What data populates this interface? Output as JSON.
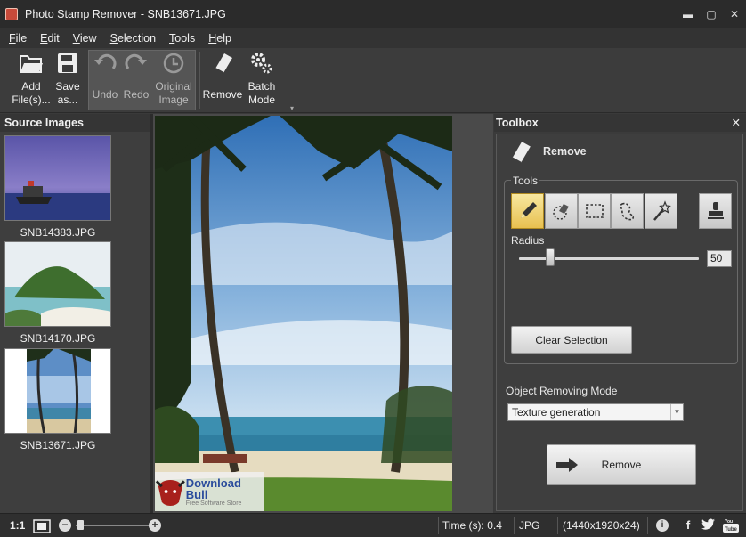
{
  "window": {
    "title": "Photo Stamp Remover - SNB13671.JPG",
    "min": "▬",
    "max": "▢",
    "close": "✕"
  },
  "menu": [
    {
      "label": "File",
      "accel": "F",
      "rest": "ile"
    },
    {
      "label": "Edit",
      "accel": "E",
      "rest": "dit"
    },
    {
      "label": "View",
      "accel": "V",
      "rest": "iew"
    },
    {
      "label": "Selection",
      "accel": "S",
      "rest": "election"
    },
    {
      "label": "Tools",
      "accel": "T",
      "rest": "ools"
    },
    {
      "label": "Help",
      "accel": "H",
      "rest": "elp"
    }
  ],
  "toolbar": {
    "add_files": "Add File(s)...",
    "add_files_l1": "Add",
    "add_files_l2": "File(s)...",
    "save_as_l1": "Save",
    "save_as_l2": "as...",
    "undo": "Undo",
    "redo": "Redo",
    "original_l1": "Original",
    "original_l2": "Image",
    "remove": "Remove",
    "batch_l1": "Batch",
    "batch_l2": "Mode",
    "overflow": "▾"
  },
  "source_images": {
    "title": "Source Images",
    "items": [
      {
        "name": "SNB14383.JPG"
      },
      {
        "name": "SNB14170.JPG"
      },
      {
        "name": "SNB13671.JPG"
      }
    ]
  },
  "watermark": {
    "title": "Download Bull",
    "subtitle": "Free Software Store"
  },
  "toolbox": {
    "title": "Toolbox",
    "close": "✕",
    "mode_title": "Remove",
    "tools_label": "Tools",
    "radius_label": "Radius",
    "radius_value": "50",
    "radius_fraction": 0.18,
    "clear_selection": "Clear Selection",
    "orm_label": "Object Removing Mode",
    "orm_value": "Texture generation",
    "remove_button": "Remove"
  },
  "status": {
    "zoom_label": "1:1",
    "time": "Time (s): 0.4",
    "format": "JPG",
    "dimensions": "(1440x1920x24)"
  },
  "colors": {
    "accent_tool": "#e8c050",
    "background": "#3a3a3a"
  }
}
